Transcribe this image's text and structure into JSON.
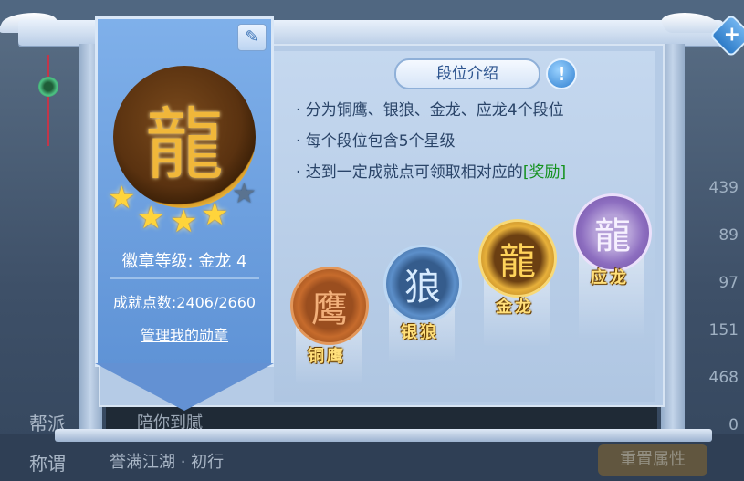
{
  "dialog": {
    "close_icon": "close-icon",
    "edit_icon": "edit-icon"
  },
  "badge": {
    "level_text": "徽章等级: 金龙 4",
    "points_text": "成就点数:2406/2660",
    "manage_label": "管理我的勋章",
    "stars_filled": 4,
    "stars_total": 5
  },
  "intro": {
    "title": "段位介绍",
    "info_icon": "info-icon",
    "rules": [
      "· 分为铜鹰、银狼、金龙、应龙4个段位",
      "· 每个段位包含5个星级",
      "· 达到一定成就点可领取相对应的"
    ],
    "reward_link": "[奖励]"
  },
  "ranks": [
    {
      "name": "铜鹰",
      "icon": "eagle-icon"
    },
    {
      "name": "银狼",
      "icon": "wolf-icon"
    },
    {
      "name": "金龙",
      "icon": "dragon-icon"
    },
    {
      "name": "应龙",
      "icon": "winged-dragon-icon"
    }
  ],
  "background": {
    "right_numbers": [
      "439",
      "89",
      "97",
      "151",
      "468",
      "0"
    ],
    "left_labels": [
      "帮派",
      "称谓"
    ],
    "strip_text": "陪你到腻",
    "bottom_text": "誉满江湖 · 初行",
    "bottom_button": "重置属性"
  }
}
